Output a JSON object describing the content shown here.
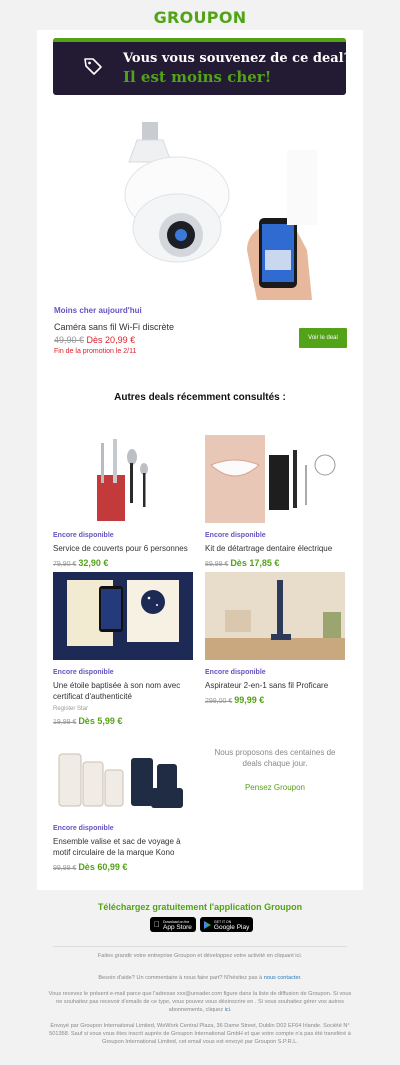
{
  "brand": {
    "logo": "GROUPON"
  },
  "banner": {
    "line1": "Vous vous souvenez de ce deal?",
    "line2": "Il est moins cher!"
  },
  "hero": {
    "label": "Moins cher aujourd'hui",
    "name": "Caméra sans fil Wi-Fi discrète",
    "old_price": "49,90 €",
    "new_price": "Dès 20,99 €",
    "promo_end": "Fin de la promotion le 2/11",
    "cta": "Voir le deal"
  },
  "section": {
    "title": "Autres deals récemment consultés :"
  },
  "deals": [
    {
      "label": "Encore disponible",
      "name": "Service de couverts pour 6 personnes",
      "sub": "",
      "old_price": "79,90 €",
      "new_price": "32,90 €"
    },
    {
      "label": "Encore disponible",
      "name": "Kit de détartrage dentaire électrique",
      "sub": "",
      "old_price": "89,99 €",
      "new_price": "Dès 17,85 €"
    },
    {
      "label": "Encore disponible",
      "name": "Une étoile baptisée à son nom avec certificat d'authenticité",
      "sub": "Register Star",
      "old_price": "19,99 €",
      "new_price": "Dès 5,99 €"
    },
    {
      "label": "Encore disponible",
      "name": "Aspirateur 2-en-1 sans fil Proficare",
      "sub": "",
      "old_price": "299,00 €",
      "new_price": "99,99 €"
    },
    {
      "label": "Encore disponible",
      "name": "Ensemble valise et sac de voyage à motif circulaire de la marque Kono",
      "sub": "",
      "old_price": "99,99 €",
      "new_price": "Dès 60,99 €"
    }
  ],
  "promo": {
    "text": "Nous proposons des centaines de deals chaque jour.",
    "link": "Pensez Groupon"
  },
  "app": {
    "title": "Téléchargez gratuitement l'application Groupon",
    "appstore_small": "Download on the",
    "appstore_big": "App Store",
    "play_small": "GET IT ON",
    "play_big": "Google Play"
  },
  "footer": {
    "line1": "Faites grandir votre entreprise Groupon et développez votre activité en cliquant ici.",
    "help_prefix": "Besoin d'aide? Un commentaire à nous faire part? N'hésitez pas à",
    "help_link": "nous contacter",
    "legal1": "Vous recevez le présent e-mail parce que l'adresse xxx@ureader.com figure dans la liste de diffusion de Groupon. Si vous ne souhaitez pas recevoir d'emails de ce type, vous pouvez vous désinscrire en . Si vous souhaitez gérer vos autres abonnements, cliquez",
    "legal1_link": "ici",
    "legal2": "Envoyé par Groupon International Limited, WeWork Central Plaza, 36 Dame Street, Dublin D02 EF64 Irlande. Société N° 501358. Sauf si vous vous êtes inscrit auprès de Groupon International GmbH et que votre compte n'a pas été transféré à Groupon International Limited, cet email vous est envoyé par Groupon S.P.R.L."
  },
  "colors": {
    "brand_green": "#53a318",
    "banner_bg": "#231a33",
    "label_purple": "#6554c0",
    "price_red": "#e01e2a"
  }
}
